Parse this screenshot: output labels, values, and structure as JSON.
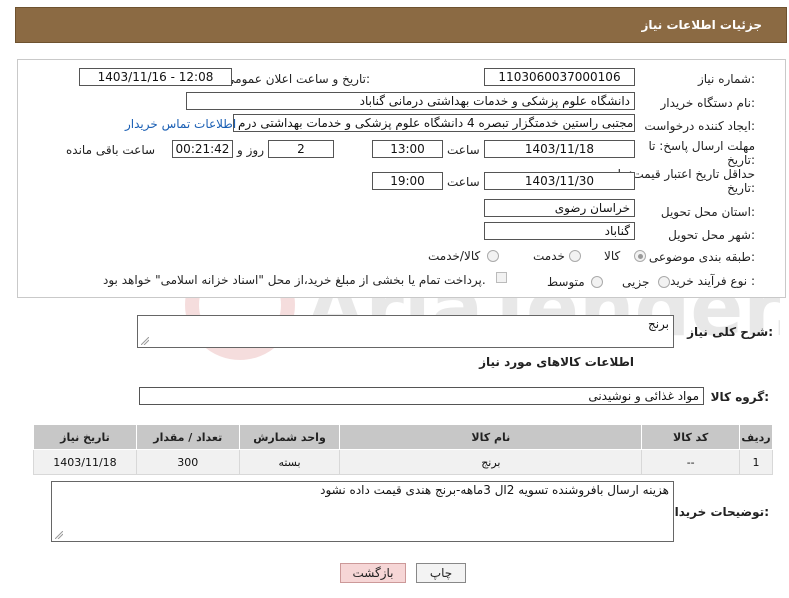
{
  "header": {
    "title": "جزئیات اطلاعات نیاز"
  },
  "form": {
    "need_number_label": "شماره نیاز:",
    "need_number": "1103060037000106",
    "announce_label": "تاریخ و ساعت اعلان عمومی:",
    "announce_value": "1403/11/16 - 12:08",
    "buyer_label": "نام دستگاه خریدار:",
    "buyer_value": "دانشگاه علوم پزشکی و خدمات بهداشتی درمانی گناباد",
    "creator_label": "ایجاد کننده درخواست:",
    "creator_value": "مجتبی راستین خدمتگزار تبصره 4 دانشگاه علوم پزشکی و خدمات بهداشتی درم",
    "contact_link": "اطلاعات تماس خریدار",
    "deadline_label_1": "مهلت ارسال پاسخ: تا",
    "deadline_label_2": "تاریخ:",
    "deadline_date": "1403/11/18",
    "deadline_time_label": "ساعت",
    "deadline_time": "13:00",
    "days_value": "2",
    "days_label": "روز و",
    "remaining_time": "00:21:42",
    "remaining_label": "ساعت باقی مانده",
    "validity_label_1": "حداقل تاریخ اعتبار قیمت: تا",
    "validity_label_2": "تاریخ:",
    "validity_date": "1403/11/30",
    "validity_time_label": "ساعت",
    "validity_time": "19:00",
    "province_label": "استان محل تحویل:",
    "province_value": "خراسان رضوی",
    "city_label": "شهر محل تحویل:",
    "city_value": "گناباد",
    "category_label": "طبقه بندی موضوعی:",
    "category_options": [
      "کالا",
      "خدمت",
      "کالا/خدمت"
    ],
    "category_selected": "کالا",
    "process_label": "نوع فرآیند خرید :",
    "process_options": [
      "جزیی",
      "متوسط"
    ],
    "payment_note": "پرداخت تمام یا بخشی از مبلغ خرید،از محل \"اسناد خزانه اسلامی\" خواهد بود."
  },
  "summary": {
    "label": "شرح کلی نیاز:",
    "value": "برنج"
  },
  "goods": {
    "section_title": "اطلاعات کالاهای مورد نیاز",
    "group_label": "گروه کالا:",
    "group_value": "مواد غذائی و نوشیدنی",
    "columns": [
      "ردیف",
      "کد کالا",
      "نام کالا",
      "واحد شمارش",
      "تعداد / مقدار",
      "تاریخ نیاز"
    ],
    "rows": [
      {
        "index": "1",
        "code": "--",
        "name": "برنج",
        "unit": "بسته",
        "qty": "300",
        "date": "1403/11/18"
      }
    ]
  },
  "buyer_notes": {
    "label": "توضیحات خریدار:",
    "value": "هزینه ارسال بافروشنده تسویه 2ال 3ماهه-برنج هندی قیمت داده نشود"
  },
  "buttons": {
    "print": "چاپ",
    "back": "بازگشت"
  },
  "watermark": {
    "text": "AriaTender.net"
  }
}
